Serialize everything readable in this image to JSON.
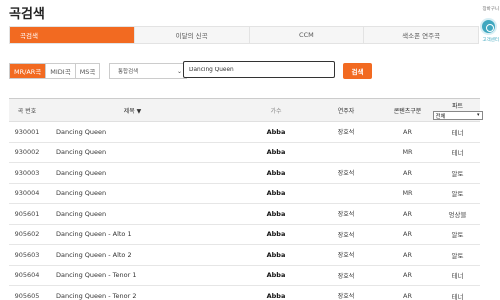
{
  "page": {
    "title": "곡검색"
  },
  "right_rail": {
    "cart_label": "장바구니",
    "support_label": "고객센터"
  },
  "tabs": [
    {
      "label": "곡검색",
      "active": true
    },
    {
      "label": "이달의 신곡",
      "active": false
    },
    {
      "label": "CCM",
      "active": false
    },
    {
      "label": "색소폰 연주곡",
      "active": false
    }
  ],
  "search": {
    "types": [
      {
        "label": "MR/AR곡",
        "active": true
      },
      {
        "label": "MIDI곡",
        "active": false
      },
      {
        "label": "MS곡",
        "active": false
      }
    ],
    "scope_selected": "통합검색",
    "query": "Dancing Queen",
    "button_label": "검색"
  },
  "table": {
    "headers": {
      "num": "곡 번호",
      "title": "제목 ▼",
      "singer": "가수",
      "player": "연주자",
      "type": "콘텐츠구분",
      "part": "파트",
      "part_filter": "전체"
    },
    "rows": [
      {
        "num": "930001",
        "title": "Dancing Queen",
        "singer": "Abba",
        "player": "장효석",
        "type": "AR",
        "part": "테너"
      },
      {
        "num": "930002",
        "title": "Dancing Queen",
        "singer": "Abba",
        "player": "",
        "type": "MR",
        "part": "테너"
      },
      {
        "num": "930003",
        "title": "Dancing Queen",
        "singer": "Abba",
        "player": "장효석",
        "type": "AR",
        "part": "알토"
      },
      {
        "num": "930004",
        "title": "Dancing Queen",
        "singer": "Abba",
        "player": "",
        "type": "MR",
        "part": "알토"
      },
      {
        "num": "905601",
        "title": "Dancing Queen",
        "singer": "Abba",
        "player": "장효석",
        "type": "AR",
        "part": "엉상블"
      },
      {
        "num": "905602",
        "title": "Dancing Queen - Alto 1",
        "singer": "Abba",
        "player": "장효석",
        "type": "AR",
        "part": "알토"
      },
      {
        "num": "905603",
        "title": "Dancing Queen - Alto 2",
        "singer": "Abba",
        "player": "장효석",
        "type": "AR",
        "part": "알토"
      },
      {
        "num": "905604",
        "title": "Dancing Queen - Tenor 1",
        "singer": "Abba",
        "player": "장효석",
        "type": "AR",
        "part": "테너"
      },
      {
        "num": "905605",
        "title": "Dancing Queen - Tenor 2",
        "singer": "Abba",
        "player": "장효석",
        "type": "AR",
        "part": "테너"
      }
    ]
  },
  "colors": {
    "accent": "#f26a21",
    "support": "#3fa7bf"
  }
}
